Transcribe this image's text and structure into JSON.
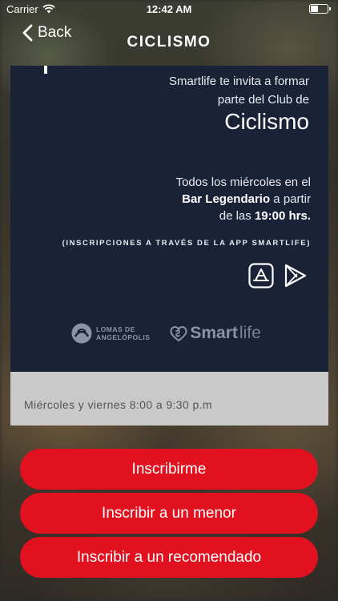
{
  "status_bar": {
    "carrier": "Carrier",
    "time": "12:42 AM",
    "battery_level": 0.45
  },
  "nav": {
    "back_label": "Back",
    "title": "CICLISMO"
  },
  "card": {
    "invite_line1": "Smartlife te invita a formar",
    "invite_line2": "parte del Club de",
    "club_name": "Ciclismo",
    "schedule_line1": "Todos los miércoles en el",
    "schedule_place": "Bar Legendario",
    "schedule_line2_rest": " a partir",
    "schedule_line3_prefix": "de las ",
    "schedule_time": "19:00 hrs.",
    "inscripciones_note": "(INSCRIPCIONES A TRAVÉS DE LA APP SMARTLIFE)",
    "logo_lomas_line1": "LOMAS DE",
    "logo_lomas_line2": "ANGELÓPOLIS",
    "logo_smart": "Smart",
    "logo_life": "life",
    "footer_hours": "Miércoles y viernes 8:00 a 9:30 p.m"
  },
  "buttons": {
    "enroll": "Inscribirme",
    "enroll_minor": "Inscribir a un menor",
    "enroll_recommended": "Inscribir a un recomendado"
  },
  "colors": {
    "card_bg": "#192237",
    "button_red": "#e1111f",
    "footer_gray": "#c9c9c9"
  }
}
